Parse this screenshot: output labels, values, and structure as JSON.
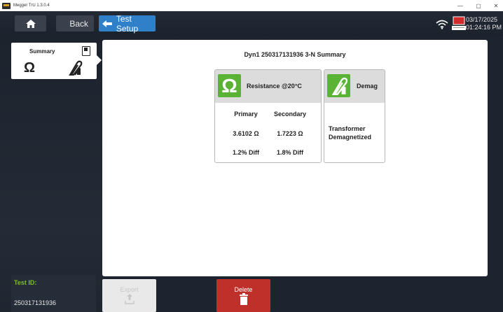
{
  "window": {
    "title": "Megger TrU 1.3.0.4",
    "minimize": "—",
    "maximize": "▢",
    "close": "✕"
  },
  "header": {
    "back_label": "Back",
    "test_setup_label": "Test Setup",
    "date": "03/17/2025",
    "time": "01:24:16 PM"
  },
  "sidebar": {
    "summary_label": "Summary",
    "tests": [
      {
        "icon": "omega-icon",
        "name": "resistance"
      },
      {
        "icon": "demag-icon",
        "name": "demag"
      }
    ],
    "test_id_label": "Test ID:",
    "test_id_value": "250317131936"
  },
  "main": {
    "title": "Dyn1 250317131936 3-N Summary",
    "resistance": {
      "title": "Resistance @20°C",
      "primary_header": "Primary",
      "secondary_header": "Secondary",
      "primary_value": "3.6102 Ω",
      "secondary_value": "1.7223 Ω",
      "primary_diff": "1.2% Diff",
      "secondary_diff": "1.8% Diff"
    },
    "demag": {
      "title": "Demag",
      "status_line1": "Transformer",
      "status_line2": "Demagnetized"
    }
  },
  "footer": {
    "export_label": "Export",
    "delete_label": "Delete"
  },
  "colors": {
    "accent_blue": "#2f7fc9",
    "green": "#5bb336",
    "delete_red": "#c0302b",
    "test_id_green": "#7dbf2d"
  }
}
